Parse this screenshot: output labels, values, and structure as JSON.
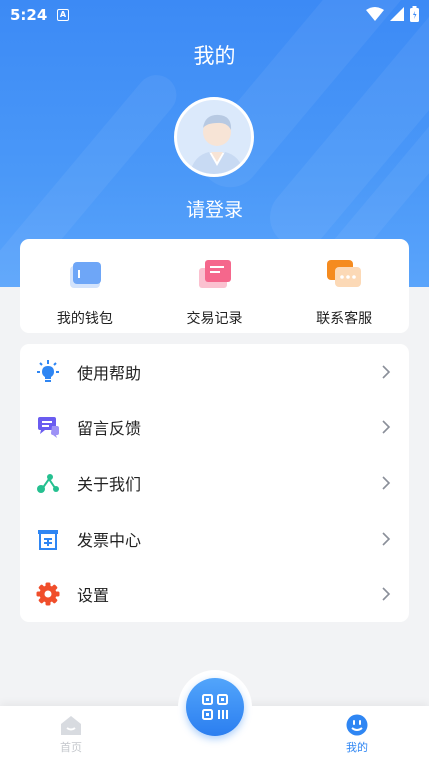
{
  "status_bar": {
    "time": "5:24",
    "notif_letter": "A"
  },
  "header": {
    "title": "我的",
    "login_text": "请登录"
  },
  "quick_actions": [
    {
      "label": "我的钱包",
      "icon": "wallet-icon"
    },
    {
      "label": "交易记录",
      "icon": "records-icon"
    },
    {
      "label": "联系客服",
      "icon": "chat-support-icon"
    }
  ],
  "menu": [
    {
      "label": "使用帮助",
      "icon": "lightbulb-icon"
    },
    {
      "label": "留言反馈",
      "icon": "feedback-icon"
    },
    {
      "label": "关于我们",
      "icon": "share-nodes-icon"
    },
    {
      "label": "发票中心",
      "icon": "invoice-icon"
    },
    {
      "label": "设置",
      "icon": "gear-icon"
    }
  ],
  "tabbar": {
    "home_label": "首页",
    "mine_label": "我的"
  },
  "colors": {
    "accent": "#2f86f3",
    "hero": "#3c8af5"
  }
}
